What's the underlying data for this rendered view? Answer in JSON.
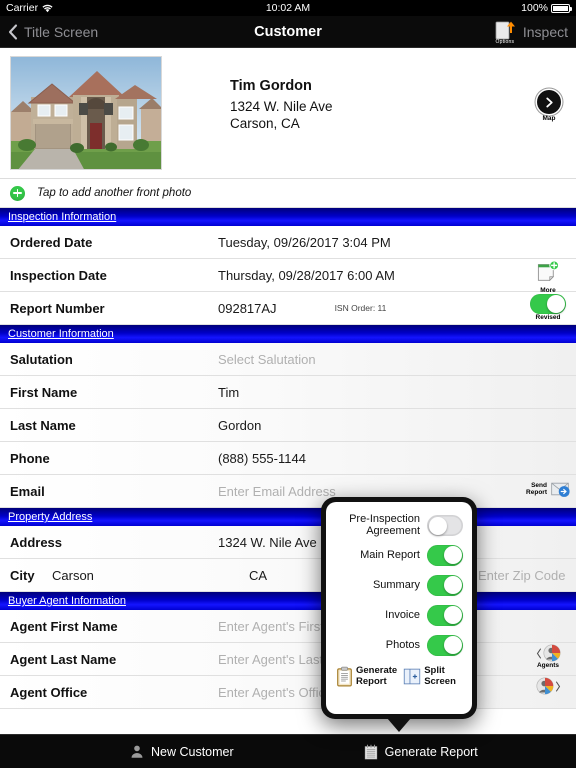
{
  "status_bar": {
    "carrier": "Carrier",
    "wifi_icon": "wifi-icon",
    "time": "10:02 AM",
    "battery_percent": "100%",
    "battery_icon": "battery-full-icon"
  },
  "nav_bar": {
    "back_icon": "chevron-left-icon",
    "back_label": "Title Screen",
    "title": "Customer",
    "options_icon": "document-upload-icon",
    "options_label": "Options",
    "inspect_label": "Inspect"
  },
  "customer_header": {
    "photo_alt": "house-front-photo",
    "name": "Tim Gordon",
    "address_line1": "1324 W. Nile Ave",
    "address_line2": "Carson, CA",
    "map_icon": "chevron-right-circle-icon",
    "map_label": "Map",
    "add_photo_icon": "plus-circle-icon",
    "add_photo_text": "Tap to add another front photo"
  },
  "sections": [
    {
      "title": "Inspection Information",
      "rows": [
        {
          "label": "Ordered Date",
          "value": "Tuesday, 09/26/2017 3:04 PM",
          "placeholder": false
        },
        {
          "label": "Inspection Date",
          "value": "Thursday, 09/28/2017 6:00 AM",
          "placeholder": false,
          "accessory": {
            "type": "icon",
            "icon": "note-add-icon",
            "caption": "More"
          }
        },
        {
          "label": "Report Number",
          "value": "092817AJ",
          "placeholder": false,
          "sub_value": "ISN Order: 11",
          "accessory": {
            "type": "switch",
            "state": "on",
            "caption": "Revised"
          }
        }
      ]
    },
    {
      "title": "Customer Information",
      "rows": [
        {
          "label": "Salutation",
          "value": "Select Salutation",
          "placeholder": true
        },
        {
          "label": "First Name",
          "value": "Tim",
          "placeholder": false
        },
        {
          "label": "Last Name",
          "value": "Gordon",
          "placeholder": false
        },
        {
          "label": "Phone",
          "value": "(888) 555-1144",
          "placeholder": false
        },
        {
          "label": "Email",
          "value": "Enter Email Address",
          "placeholder": true,
          "accessory": {
            "type": "icon",
            "icon": "send-mail-icon",
            "caption": "Send\nReport"
          }
        }
      ]
    },
    {
      "title": "Property Address",
      "rows": [
        {
          "label": "Address",
          "value": "1324 W. Nile Ave",
          "placeholder": false
        },
        {
          "label": "City",
          "value": "Carson",
          "inline": true,
          "state": "CA",
          "zip": "Enter Zip Code"
        }
      ]
    },
    {
      "title": "Buyer Agent Information",
      "rows": [
        {
          "label": "Agent First Name",
          "value": "Enter Agent's First Name",
          "placeholder": true
        },
        {
          "label": "Agent Last Name",
          "value": "Enter Agent's Last Name",
          "placeholder": true,
          "accessory": {
            "type": "icon",
            "icon": "agents-icon",
            "caption": "Agents"
          }
        },
        {
          "label": "Agent Office",
          "value": "Enter Agent's Office",
          "placeholder": true
        }
      ]
    }
  ],
  "popover": {
    "toggles": [
      {
        "label": "Pre-Inspection Agreement",
        "state": "off"
      },
      {
        "label": "Main Report",
        "state": "on"
      },
      {
        "label": "Summary",
        "state": "on"
      },
      {
        "label": "Invoice",
        "state": "on"
      },
      {
        "label": "Photos",
        "state": "on"
      }
    ],
    "actions": [
      {
        "label_line1": "Generate",
        "label_line2": "Report",
        "icon": "clipboard-icon"
      },
      {
        "label_line1": "Split",
        "label_line2": "Screen",
        "icon": "split-screen-icon"
      }
    ]
  },
  "toolbar": {
    "new_customer_icon": "person-icon",
    "new_customer_label": "New Customer",
    "generate_report_icon": "notepad-icon",
    "generate_report_label": "Generate Report"
  },
  "colors": {
    "section_blue": "#0000c8",
    "switch_green": "#35c94a",
    "accent_orange": "#ff8c00",
    "placeholder_gray": "#b0b0b0"
  }
}
